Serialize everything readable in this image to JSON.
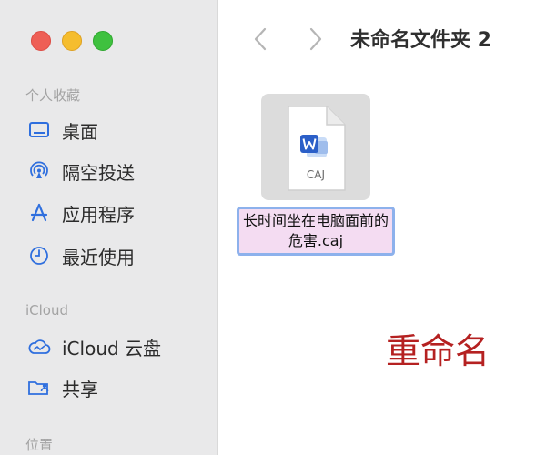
{
  "window": {
    "traffic_lights": {
      "close_color": "#ee5f56",
      "minimize_color": "#f5bd2e",
      "zoom_color": "#3fc13f"
    }
  },
  "sidebar": {
    "sections": [
      {
        "label": "个人收藏",
        "items": [
          {
            "label": "桌面",
            "icon": "desktop-icon"
          },
          {
            "label": "隔空投送",
            "icon": "airdrop-icon"
          },
          {
            "label": "应用程序",
            "icon": "applications-icon"
          },
          {
            "label": "最近使用",
            "icon": "clock-icon"
          }
        ]
      },
      {
        "label": "iCloud",
        "items": [
          {
            "label": "iCloud 云盘",
            "icon": "icloud-icon"
          },
          {
            "label": "共享",
            "icon": "shared-folder-icon"
          }
        ]
      },
      {
        "label": "位置",
        "items": []
      }
    ],
    "icon_color": "#2f6fde"
  },
  "toolbar": {
    "folder_title": "未命名文件夹 2"
  },
  "file": {
    "type_label": "CAJ",
    "name_editing": "长时间坐在电脑面前的危害.caj"
  },
  "annotation": {
    "text": "重命名",
    "color": "#b52121"
  }
}
